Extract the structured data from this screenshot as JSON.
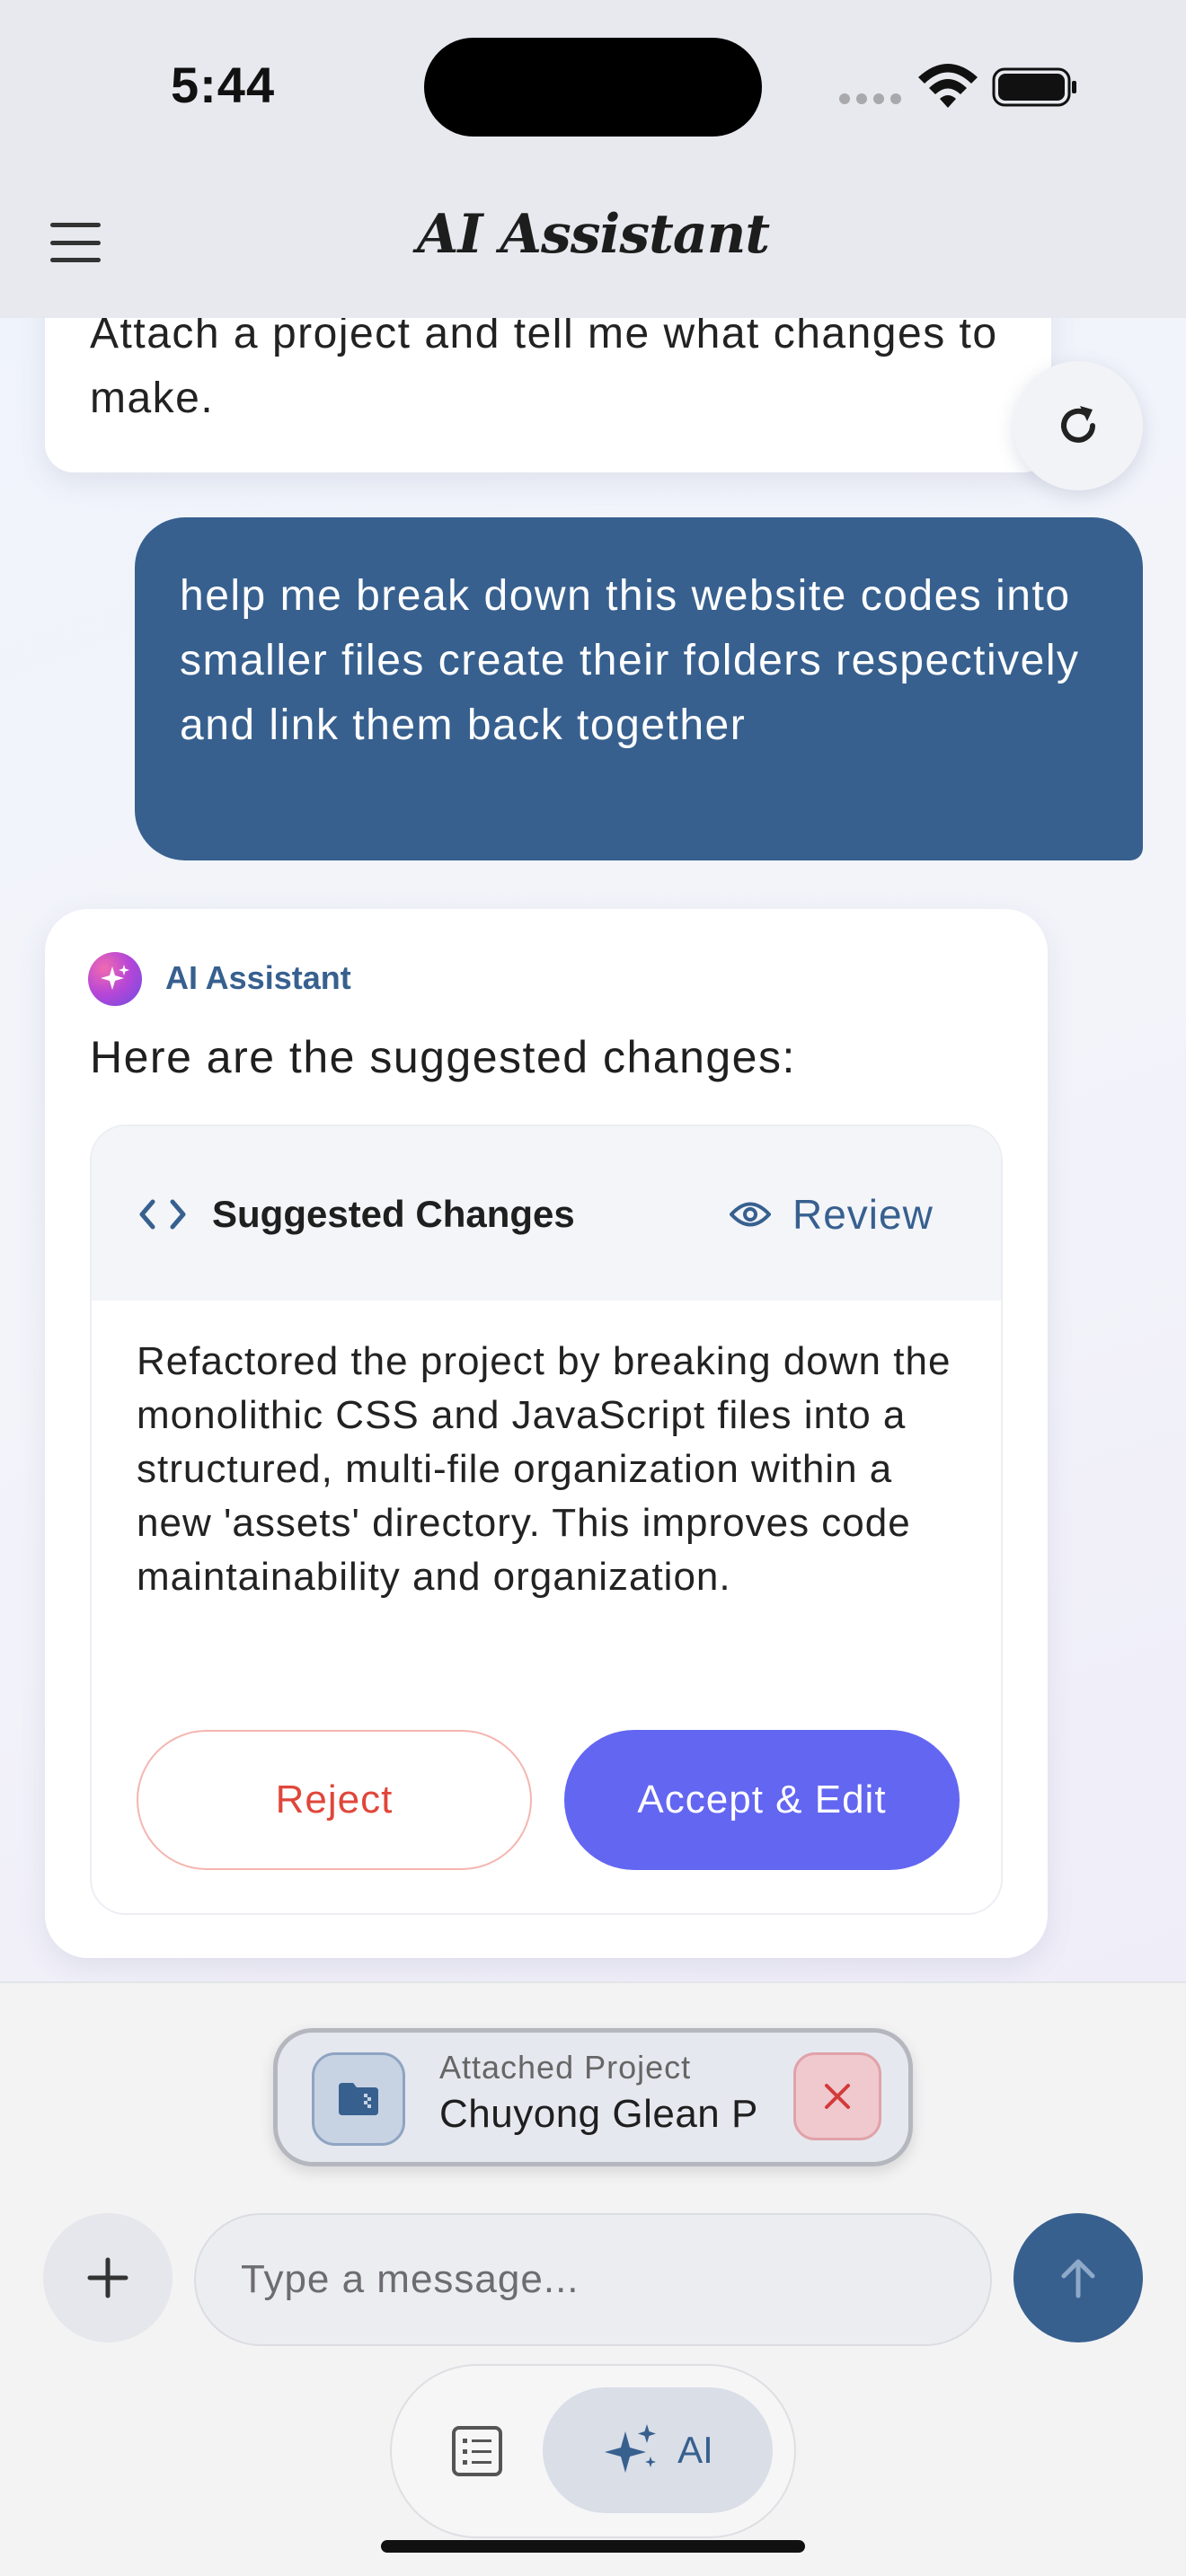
{
  "status_bar": {
    "time": "5:44"
  },
  "header": {
    "title": "AI Assistant"
  },
  "messages": {
    "assistant_prev": "Attach a project and tell me what changes to make.",
    "user": "help me break down this website codes into smaller files create their folders respectively and link them back together",
    "assistant": {
      "name": "AI Assistant",
      "intro": "Here are the suggested changes:",
      "card": {
        "title": "Suggested Changes",
        "review_label": "Review",
        "description": "Refactored the project by breaking down the monolithic CSS and JavaScript files into a structured, multi-file organization within a new 'assets' directory. This improves code maintainability and organization.",
        "reject_label": "Reject",
        "accept_label": "Accept & Edit"
      }
    }
  },
  "composer": {
    "attached_label": "Attached Project",
    "attached_name": "Chuyong Glean P",
    "placeholder": "Type a message..."
  },
  "tabs": {
    "ai_label": "AI"
  },
  "colors": {
    "primary": "#37608f",
    "accent": "#6366f1",
    "reject": "#e0463a"
  }
}
